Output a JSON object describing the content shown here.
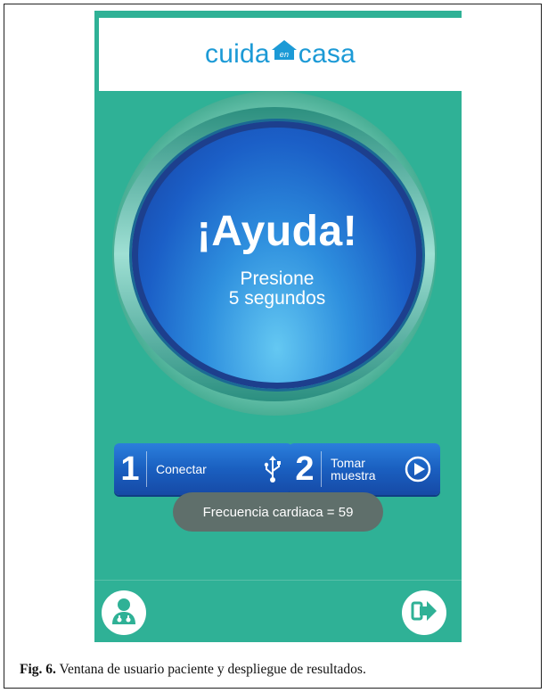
{
  "app": {
    "logo": {
      "part1": "cuida",
      "house_text": "en",
      "part2": "casa"
    }
  },
  "help_button": {
    "title": "¡Ayuda!",
    "line1": "Presione",
    "line2": "5 segundos"
  },
  "actions": [
    {
      "number": "1",
      "label_line1": "Conectar",
      "label_line2": "",
      "icon": "usb-icon"
    },
    {
      "number": "2",
      "label_line1": "Tomar",
      "label_line2": "muestra",
      "icon": "play-icon"
    }
  ],
  "toast": {
    "text": "Frecuencia cardiaca = 59"
  },
  "footer": {
    "left_icon": "doctor-icon",
    "right_icon": "exit-icon"
  },
  "caption": {
    "label": "Fig. 6.",
    "text": " Ventana de usuario paciente y despliegue de resultados."
  },
  "colors": {
    "background": "#2fb196",
    "button_blue": "#1a5fc0",
    "logo_blue": "#1c9ad6",
    "toast": "#5f6f6b"
  }
}
